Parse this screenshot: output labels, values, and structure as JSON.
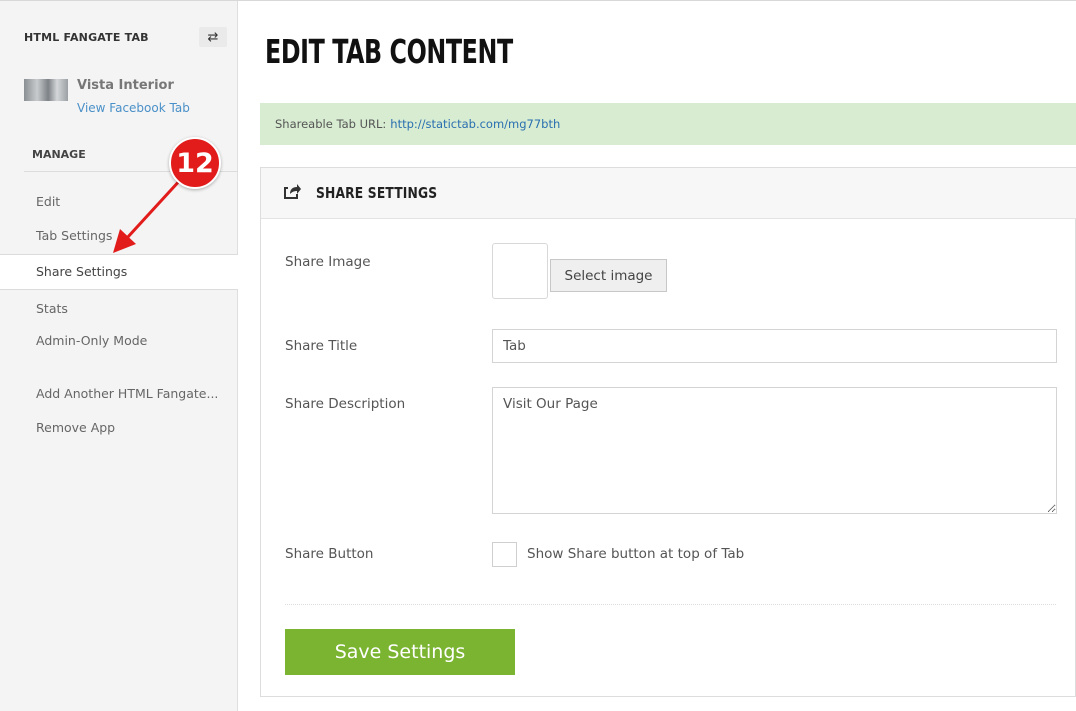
{
  "sidebar": {
    "app_title": "HTML FANGATE TAB",
    "page_name": "Vista Interior",
    "view_link": "View Facebook Tab",
    "manage_label": "MANAGE",
    "items": [
      {
        "label": "Edit"
      },
      {
        "label": "Tab Settings"
      },
      {
        "label": "Share Settings",
        "active": true
      },
      {
        "label": "Stats"
      },
      {
        "label": "Admin-Only Mode"
      },
      {
        "label": "Add Another HTML Fangate..."
      },
      {
        "label": "Remove App"
      }
    ]
  },
  "annotation": {
    "step_number": "12"
  },
  "main": {
    "title": "EDIT TAB CONTENT",
    "url_label": "Shareable Tab URL:",
    "url": "http://statictab.com/mg77bth",
    "panel": {
      "title": "SHARE SETTINGS",
      "share_image_label": "Share Image",
      "select_image_button": "Select image",
      "share_title_label": "Share Title",
      "share_title_value": "Tab",
      "share_description_label": "Share Description",
      "share_description_value": "Visit Our Page",
      "share_button_label": "Share Button",
      "share_button_checkbox_label": "Show Share button at top of Tab",
      "share_button_checked": false,
      "save_button": "Save Settings"
    }
  },
  "colors": {
    "accent_green": "#7ab431",
    "url_bar_bg": "#d7ecd1",
    "link_blue": "#2a6fb0",
    "annotation_red": "#e21b1b"
  },
  "icons": {
    "switch": "swap-arrows-icon",
    "share": "share-arrow-icon"
  }
}
